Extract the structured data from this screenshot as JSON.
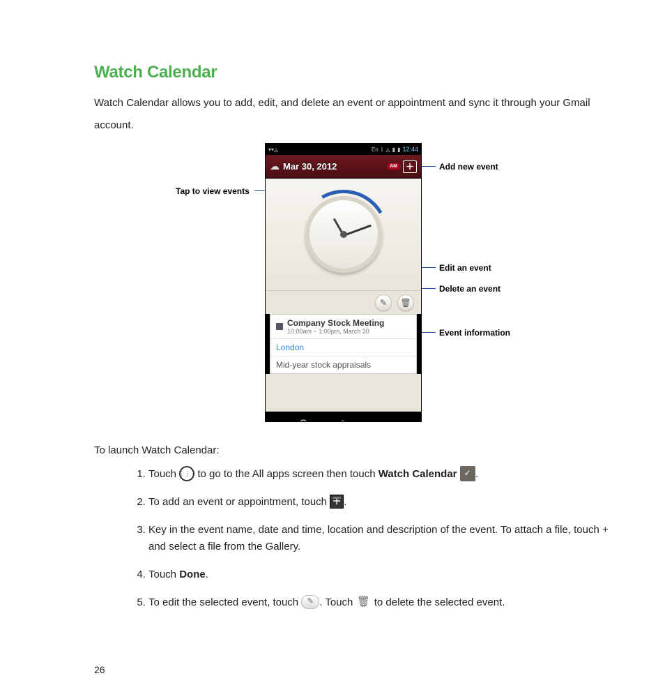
{
  "heading": "Watch Calendar",
  "intro": "Watch Calendar allows you to add, edit, and delete an event or appointment and sync it through your Gmail account.",
  "labels": {
    "tap_view": "Tap to view events",
    "add_new": "Add new event",
    "edit": "Edit an event",
    "delete": "Delete an event",
    "info": "Event information"
  },
  "phone": {
    "status_time": "12:44",
    "status_lang": "En",
    "date": "Mar 30, 2012",
    "ampm": "AM",
    "event_title": "Company Stock Meeting",
    "event_time": "10:00am ~ 1:00pm, March 30",
    "event_location": "London",
    "event_desc": "Mid-year stock appraisals"
  },
  "prelist": "To launch Watch Calendar:",
  "steps": {
    "s1a": "Touch ",
    "s1b": " to go to the All apps screen then touch ",
    "s1_bold": "Watch Calendar",
    "s1c": " ",
    "s1d": ".",
    "s2a": "To add an event or appointment, touch ",
    "s2b": ".",
    "s3": "Key in the event name, date and time, location and description of the event. To attach a file, touch + and select a file from the Gallery.",
    "s4a": "Touch ",
    "s4_bold": "Done",
    "s4b": ".",
    "s5a": "To edit the selected event, touch ",
    "s5b": ". Touch ",
    "s5c": " to delete the selected event."
  },
  "page_number": "26"
}
